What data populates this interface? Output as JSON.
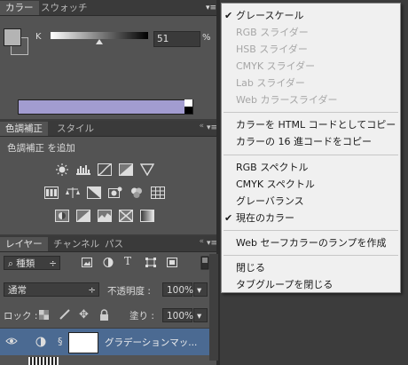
{
  "color_panel": {
    "tabs": [
      "カラー",
      "スウォッチ"
    ],
    "slider_label": "K",
    "slider_value": "51",
    "slider_unit": "%",
    "ramp_color": "#a29cd0"
  },
  "adjustments_panel": {
    "tabs": [
      "色調補正",
      "スタイル"
    ],
    "title": "色調補正 を追加"
  },
  "layers_panel": {
    "tabs": [
      "レイヤー",
      "チャンネル",
      "パス"
    ],
    "filter_kind": "種類",
    "blend_mode": "通常",
    "opacity_label": "不透明度 :",
    "opacity_value": "100%",
    "lock_label": "ロック :",
    "fill_label": "塗り :",
    "fill_value": "100%",
    "layer_name": "グラデーションマッ..."
  },
  "context_menu": {
    "items": [
      {
        "label": "グレースケール",
        "checked": true,
        "enabled": true
      },
      {
        "label": "RGB スライダー",
        "checked": false,
        "enabled": false
      },
      {
        "label": "HSB スライダー",
        "checked": false,
        "enabled": false
      },
      {
        "label": "CMYK スライダー",
        "checked": false,
        "enabled": false
      },
      {
        "label": "Lab スライダー",
        "checked": false,
        "enabled": false
      },
      {
        "label": "Web カラースライダー",
        "checked": false,
        "enabled": false
      },
      {
        "label": "カラーを HTML コードとしてコピー",
        "checked": false,
        "enabled": true
      },
      {
        "label": "カラーの 16 進コードをコピー",
        "checked": false,
        "enabled": true
      },
      {
        "label": "RGB スペクトル",
        "checked": false,
        "enabled": true
      },
      {
        "label": "CMYK スペクトル",
        "checked": false,
        "enabled": true
      },
      {
        "label": "グレーバランス",
        "checked": false,
        "enabled": true
      },
      {
        "label": "現在のカラー",
        "checked": true,
        "enabled": true
      },
      {
        "label": "Web セーフカラーのランプを作成",
        "checked": false,
        "enabled": true
      },
      {
        "label": "閉じる",
        "checked": false,
        "enabled": true
      },
      {
        "label": "タブグループを閉じる",
        "checked": false,
        "enabled": true
      }
    ]
  }
}
